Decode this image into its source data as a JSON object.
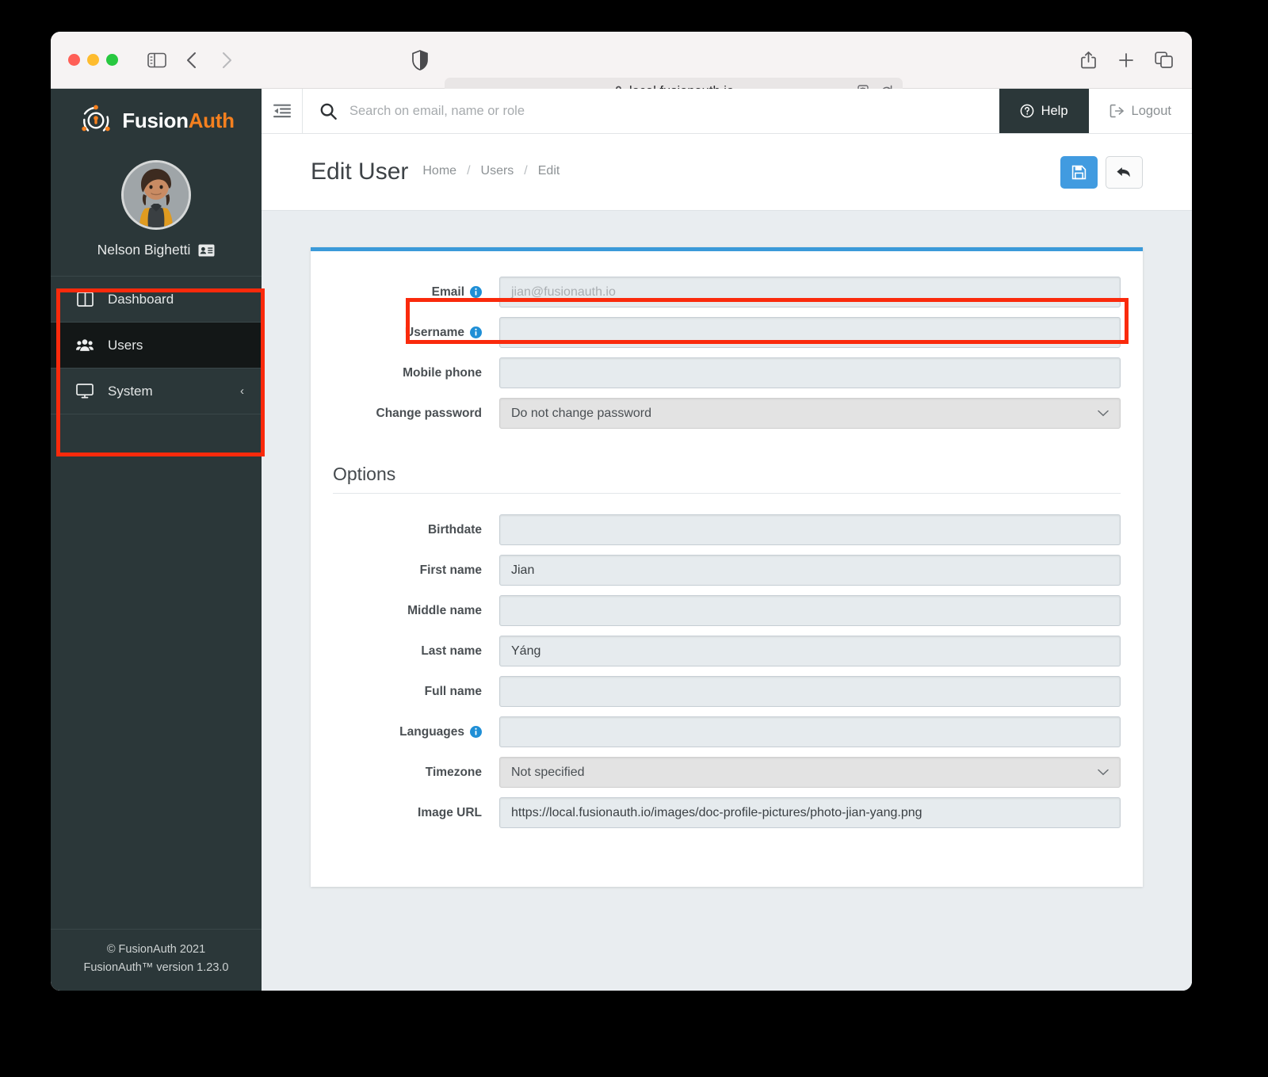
{
  "browser": {
    "url": "local.fusionauth.io",
    "lock_icon": "lock-icon",
    "shield_icon": "shield-icon",
    "translate_icon": "translate-icon",
    "reload_icon": "reload-icon",
    "sidebar_toggle_icon": "sidebar-toggle-icon",
    "back_icon": "back-arrow-icon",
    "forward_icon": "forward-arrow-icon",
    "share_icon": "share-icon",
    "new_tab_icon": "plus-icon",
    "tab_overview_icon": "tab-overview-icon"
  },
  "sidebar": {
    "brand": {
      "fusion": "Fusion",
      "auth": "Auth",
      "logo_icon": "fusionauth-logo-icon"
    },
    "user": {
      "name": "Nelson Bighetti",
      "badge_icon": "id-card-icon",
      "avatar_icon": "avatar-photo"
    },
    "items": [
      {
        "label": "Dashboard",
        "icon": "dashboard-icon",
        "active": false,
        "chevron": ""
      },
      {
        "label": "Users",
        "icon": "users-icon",
        "active": true,
        "chevron": ""
      },
      {
        "label": "System",
        "icon": "monitor-icon",
        "active": false,
        "chevron": "‹"
      }
    ],
    "footer": {
      "copyright": "© FusionAuth 2021",
      "version": "FusionAuth™ version 1.23.0"
    }
  },
  "topbar": {
    "collapse_icon": "collapse-sidebar-icon",
    "search": {
      "placeholder": "Search on email, name or role",
      "value": "",
      "icon": "search-icon"
    },
    "help": {
      "label": "Help",
      "icon": "question-circle-icon"
    },
    "logout": {
      "label": "Logout",
      "icon": "logout-icon"
    }
  },
  "page": {
    "title": "Edit User",
    "breadcrumb": [
      "Home",
      "Users",
      "Edit"
    ],
    "breadcrumb_separator": "/",
    "actions": {
      "save": {
        "icon": "save-floppy-icon",
        "color": "#419be0"
      },
      "back": {
        "icon": "back-undo-arrow-icon",
        "color": "#fbfbfb"
      }
    }
  },
  "form": {
    "fields": [
      {
        "label": "Email",
        "info": true,
        "value": "",
        "placeholder": "jian@fusionauth.io",
        "type": "text",
        "highlighted": true
      },
      {
        "label": "Username",
        "info": true,
        "value": "",
        "placeholder": "",
        "type": "text"
      },
      {
        "label": "Mobile phone",
        "info": false,
        "value": "",
        "placeholder": "",
        "type": "text"
      },
      {
        "label": "Change password",
        "info": false,
        "value": "Do not change password",
        "placeholder": "",
        "type": "select"
      }
    ],
    "options_section": {
      "title": "Options",
      "fields": [
        {
          "label": "Birthdate",
          "info": false,
          "value": "",
          "placeholder": "",
          "type": "text"
        },
        {
          "label": "First name",
          "info": false,
          "value": "Jian",
          "placeholder": "",
          "type": "text"
        },
        {
          "label": "Middle name",
          "info": false,
          "value": "",
          "placeholder": "",
          "type": "text"
        },
        {
          "label": "Last name",
          "info": false,
          "value": "Yáng",
          "placeholder": "",
          "type": "text"
        },
        {
          "label": "Full name",
          "info": false,
          "value": "",
          "placeholder": "",
          "type": "text"
        },
        {
          "label": "Languages",
          "info": true,
          "value": "",
          "placeholder": "",
          "type": "text"
        },
        {
          "label": "Timezone",
          "info": false,
          "value": "Not specified",
          "placeholder": "",
          "type": "select"
        },
        {
          "label": "Image URL",
          "info": false,
          "value": "https://local.fusionauth.io/images/doc-profile-pictures/photo-jian-yang.png",
          "placeholder": "",
          "type": "text"
        }
      ]
    }
  },
  "annotations": {
    "sidebar_box_color": "#fa2a0c",
    "email_box_color": "#fa2a0c"
  },
  "colors": {
    "sidebar_bg": "#2b3739",
    "sidebar_active_bg": "#131717",
    "accent_orange": "#f5801f",
    "accent_blue": "#3b9ad9",
    "page_bg": "#e9edf0",
    "field_bg": "#e6ebee"
  }
}
